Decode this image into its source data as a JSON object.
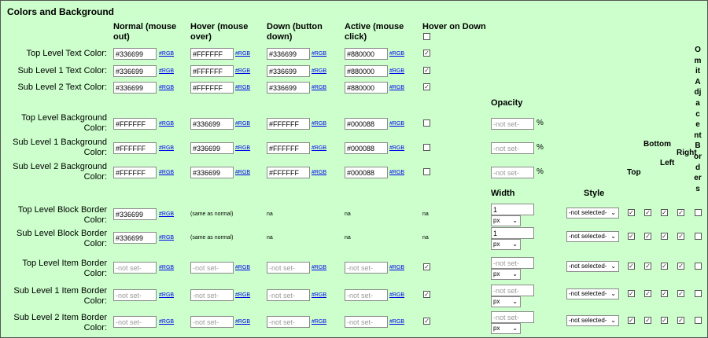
{
  "section_title": "Colors and Background",
  "columns": {
    "normal": [
      "Normal (mouse",
      "out)"
    ],
    "hover": [
      "Hover (mouse",
      "over)"
    ],
    "down": [
      "Down (button",
      "down)"
    ],
    "active": [
      "Active (mouse",
      "click)"
    ],
    "hover_on_down": "Hover on Down"
  },
  "rgb_link": "#RGB",
  "not_set": "-not set-",
  "na": "na",
  "same_as_normal": "(same as normal)",
  "opacity_label": "Opacity",
  "percent": "%",
  "width_label": "Width",
  "style_label": "Style",
  "width_unit": "px",
  "style_value": "-not selected-",
  "side_labels": [
    "Top",
    "Bottom",
    "Left",
    "Right"
  ],
  "omit_label": "Omit Adjacent Borders",
  "text_rows": [
    {
      "label": [
        "Top Level Text Color:"
      ],
      "values": [
        "#336699",
        "#FFFFFF",
        "#336699",
        "#880000"
      ],
      "hover_on_down": true
    },
    {
      "label": [
        "Sub Level 1 Text Color:"
      ],
      "values": [
        "#336699",
        "#FFFFFF",
        "#336699",
        "#880000"
      ],
      "hover_on_down": true
    },
    {
      "label": [
        "Sub Level 2 Text Color:"
      ],
      "values": [
        "#336699",
        "#FFFFFF",
        "#336699",
        "#880000"
      ],
      "hover_on_down": true
    }
  ],
  "bg_rows": [
    {
      "label": [
        "Top Level Background",
        "Color:"
      ],
      "values": [
        "#FFFFFF",
        "#336699",
        "#FFFFFF",
        "#000088"
      ],
      "hover_on_down": false
    },
    {
      "label": [
        "Sub Level 1 Background",
        "Color:"
      ],
      "values": [
        "#FFFFFF",
        "#336699",
        "#FFFFFF",
        "#000088"
      ],
      "hover_on_down": false
    },
    {
      "label": [
        "Sub Level 2 Background",
        "Color:"
      ],
      "values": [
        "#FFFFFF",
        "#336699",
        "#FFFFFF",
        "#000088"
      ],
      "hover_on_down": false
    }
  ],
  "border_rows": [
    {
      "label": [
        "Top Level Block Border",
        "Color:"
      ],
      "normal": "#336699",
      "block": true,
      "width": "1",
      "hover_on_down": null
    },
    {
      "label": [
        "Sub Level Block Border",
        "Color:"
      ],
      "normal": "#336699",
      "block": true,
      "width": "1",
      "hover_on_down": null
    },
    {
      "label": [
        "Top Level Item Border",
        "Color:"
      ],
      "normal": "",
      "block": false,
      "width": "",
      "hover_on_down": true
    },
    {
      "label": [
        "Sub Level 1 Item Border",
        "Color:"
      ],
      "normal": "",
      "block": false,
      "width": "",
      "hover_on_down": true
    },
    {
      "label": [
        "Sub Level 2 Item Border",
        "Color:"
      ],
      "normal": "",
      "block": false,
      "width": "",
      "hover_on_down": true
    }
  ]
}
